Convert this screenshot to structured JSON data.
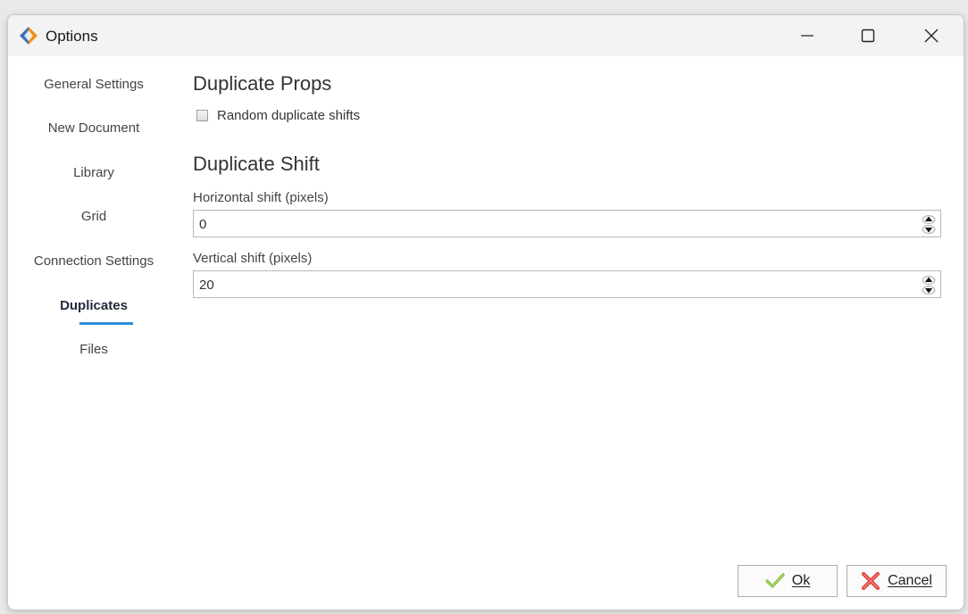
{
  "window": {
    "title": "Options"
  },
  "sidebar": {
    "items": [
      {
        "label": "General Settings"
      },
      {
        "label": "New Document"
      },
      {
        "label": "Library"
      },
      {
        "label": "Grid"
      },
      {
        "label": "Connection Settings"
      },
      {
        "label": "Duplicates",
        "active": true
      },
      {
        "label": "Files"
      }
    ]
  },
  "content": {
    "duplicate_props": {
      "title": "Duplicate Props",
      "random_shifts": {
        "label": "Random duplicate shifts",
        "checked": false
      }
    },
    "duplicate_shift": {
      "title": "Duplicate Shift",
      "horizontal": {
        "label": "Horizontal shift (pixels)",
        "value": "0"
      },
      "vertical": {
        "label": "Vertical shift (pixels)",
        "value": "20"
      }
    }
  },
  "buttons": {
    "ok": "Ok",
    "cancel": "Cancel"
  },
  "colors": {
    "accent": "#2a8fd8",
    "ok_check": "#7cb83a",
    "cancel_x": "#e0413a"
  },
  "icons": [
    "app-logo-icon",
    "minimize-icon",
    "maximize-icon",
    "close-icon",
    "checkmark-icon",
    "red-x-icon",
    "spin-up-icon",
    "spin-down-icon"
  ]
}
